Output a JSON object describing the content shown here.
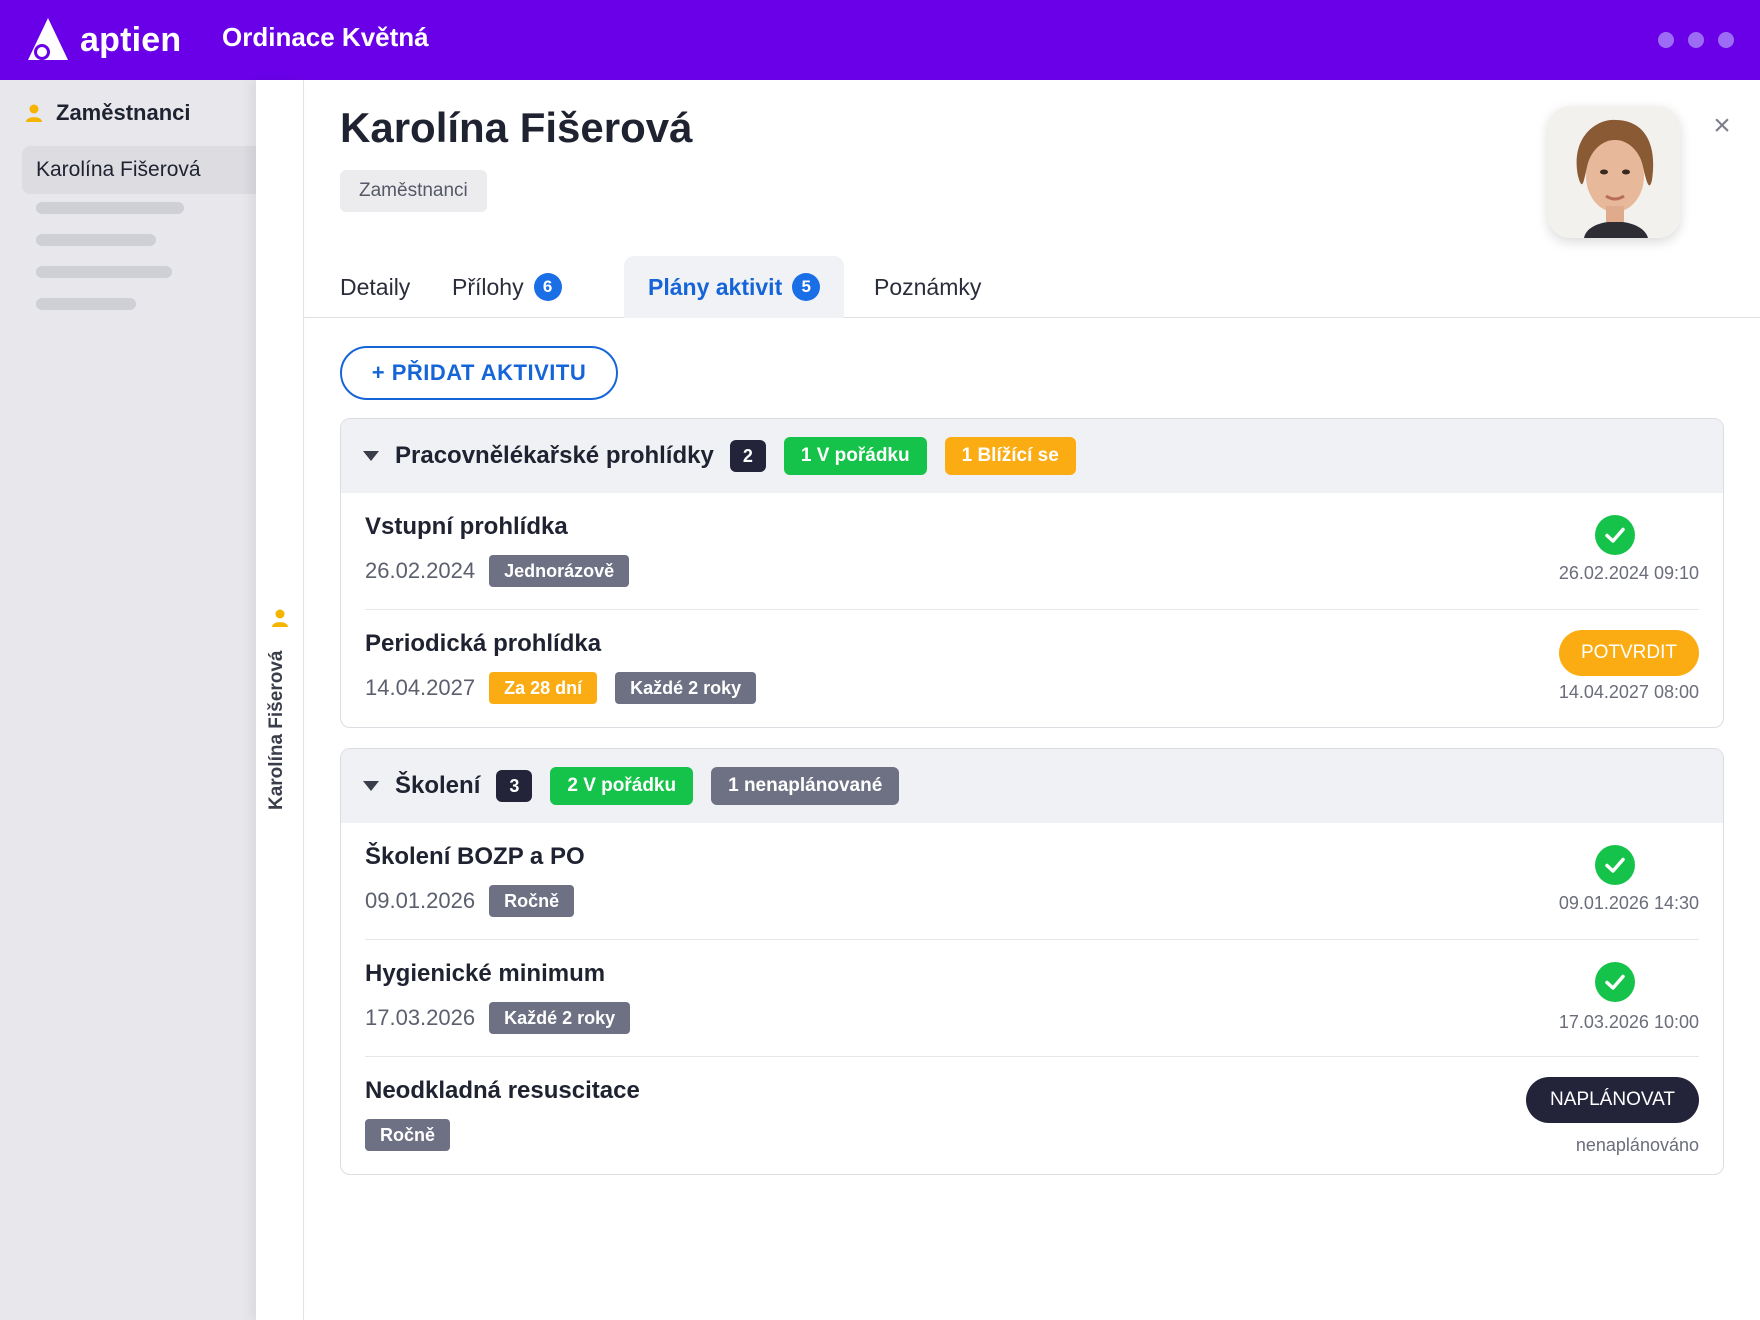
{
  "app": {
    "logo_text": "aptien",
    "org_name": "Ordinace Květná"
  },
  "sidebar": {
    "section_label": "Zaměstnanci",
    "selected_item": "Karolína Fišerová"
  },
  "strip": {
    "label": "Karolína Fišerová"
  },
  "detail": {
    "name": "Karolína Fišerová",
    "breadcrumb": "Zaměstnanci",
    "close_symbol": "×"
  },
  "tabs": [
    {
      "label": "Detaily",
      "badge": null
    },
    {
      "label": "Přílohy",
      "badge": "6"
    },
    {
      "label": "Plány aktivit",
      "badge": "5"
    },
    {
      "label": "Poznámky",
      "badge": null
    }
  ],
  "add_button": "+ PŘIDAT AKTIVITU",
  "groups": [
    {
      "title": "Pracovnělékařské prohlídky",
      "count": "2",
      "pills": [
        {
          "text": "1 V pořádku",
          "color": "#16c34a"
        },
        {
          "text": "1 Blížící se",
          "color": "#fbac12"
        }
      ],
      "rows": [
        {
          "title": "Vstupní prohlídka",
          "date": "26.02.2024",
          "tags": [
            "Jednorázově"
          ],
          "status": "done",
          "right_text": "26.02.2024 09:10"
        },
        {
          "title": "Periodická prohlídka",
          "date": "14.04.2027",
          "tags": [
            "Za 28 dní",
            "Každé 2 roky"
          ],
          "action": "POTVRDIT",
          "right_text": "14.04.2027 08:00"
        }
      ]
    },
    {
      "title": "Školení",
      "count": "3",
      "pills": [
        {
          "text": "2 V pořádku",
          "color": "#16c34a"
        },
        {
          "text": "1 nenaplánované",
          "color": "#6e7084"
        }
      ],
      "rows": [
        {
          "title": "Školení BOZP a PO",
          "date": "09.01.2026",
          "tags": [
            "Ročně"
          ],
          "status": "done",
          "right_text": "09.01.2026 14:30"
        },
        {
          "title": "Hygienické minimum",
          "date": "17.03.2026",
          "tags": [
            "Každé 2 roky"
          ],
          "status": "done",
          "right_text": "17.03.2026 10:00"
        },
        {
          "title": "Neodkladná resuscitace",
          "date": "",
          "tags": [
            "Ročně"
          ],
          "action": "NAPLÁNOVAT",
          "right_text": "nenaplánováno"
        }
      ]
    }
  ],
  "icons": {
    "logo": "aptien-logo-icon",
    "person": "person-icon",
    "close": "close-icon",
    "check": "check-circle-icon",
    "caret": "caret-down-icon"
  },
  "colors": {
    "brand": "#6a00e8",
    "accent": "#1565d8",
    "ok": "#16c34a",
    "warn": "#fbac12",
    "neutral": "#6e7084"
  }
}
